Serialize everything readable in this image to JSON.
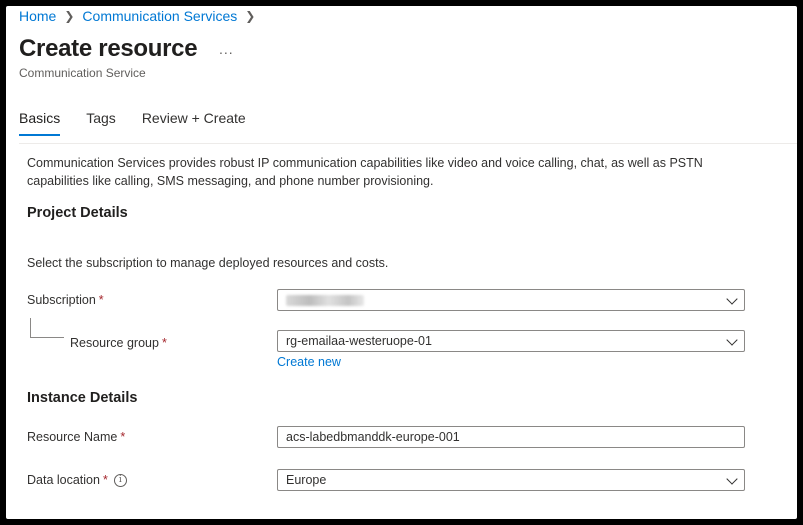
{
  "breadcrumb": {
    "home": "Home",
    "parent": "Communication Services"
  },
  "page": {
    "title": "Create resource",
    "more": "...",
    "subtitle": "Communication Service"
  },
  "tabs": [
    {
      "label": "Basics",
      "active": true
    },
    {
      "label": "Tags",
      "active": false
    },
    {
      "label": "Review + Create",
      "active": false
    }
  ],
  "description": "Communication Services provides robust IP communication capabilities like video and voice calling, chat, as well as PSTN capabilities like calling, SMS messaging, and phone number provisioning.",
  "project": {
    "heading": "Project Details",
    "help": "Select the subscription to manage deployed resources and costs.",
    "subscription_label": "Subscription",
    "resource_group_label": "Resource group",
    "resource_group_value": "rg-emailaa-westeruope-01",
    "create_new": "Create new"
  },
  "instance": {
    "heading": "Instance Details",
    "resource_name_label": "Resource Name",
    "resource_name_value": "acs-labedbmanddk-europe-001",
    "data_location_label": "Data location",
    "data_location_value": "Europe"
  },
  "required_marker": "*",
  "info_glyph": "i",
  "colors": {
    "accent": "#0078d4",
    "required": "#a4262c",
    "text": "#323130"
  }
}
